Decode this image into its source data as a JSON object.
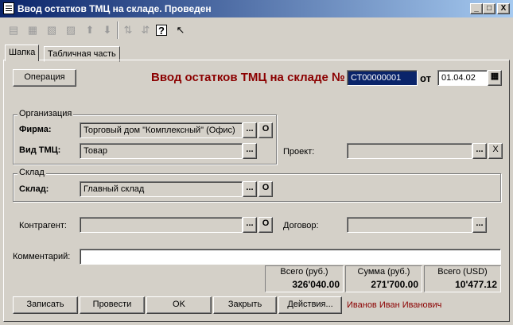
{
  "window": {
    "title": "Ввод остатков ТМЦ на складе. Проведен",
    "minimize": "_",
    "restore": "□",
    "close": "X"
  },
  "toolbar": {
    "icons": [
      "new-row-icon",
      "insert-row-icon",
      "delete-row-icon",
      "copy-row-icon",
      "move-up-icon",
      "move-down-icon",
      "sort-asc-icon",
      "sort-desc-icon",
      "help-icon",
      "context-help-icon"
    ],
    "help_label": "?"
  },
  "tabs": {
    "header": "Шапка",
    "table": "Табличная часть"
  },
  "header": {
    "operation_button": "Операция",
    "doc_heading": "Ввод остатков ТМЦ на складе №",
    "doc_number": "СТ00000001",
    "date_label": "от",
    "date": "01.04.02"
  },
  "org_group": {
    "title": "Организация",
    "firm_label": "Фирма:",
    "firm_value": "Торговый дом \"Комплексный\" (Офис)",
    "tmc_label": "Вид ТМЦ:",
    "tmc_value": "Товар"
  },
  "project": {
    "label": "Проект:",
    "value": ""
  },
  "warehouse_group": {
    "title": "Склад",
    "label": "Склад:",
    "value": "Главный склад"
  },
  "counterparty": {
    "label": "Контрагент:",
    "value": ""
  },
  "contract": {
    "label": "Договор:",
    "value": ""
  },
  "comment": {
    "label": "Комментарий:",
    "value": ""
  },
  "select_button": "...",
  "open_button": "О",
  "clear_button": "X",
  "totals": [
    {
      "label": "Всего (руб.)",
      "value": "326'040.00"
    },
    {
      "label": "Сумма (руб.)",
      "value": "271'700.00"
    },
    {
      "label": "Всего (USD)",
      "value": "10'477.12"
    }
  ],
  "buttons": {
    "save": "Записать",
    "post": "Провести",
    "ok": "OK",
    "close": "Закрыть",
    "actions": "Действия..."
  },
  "user": "Иванов Иван Иванович"
}
